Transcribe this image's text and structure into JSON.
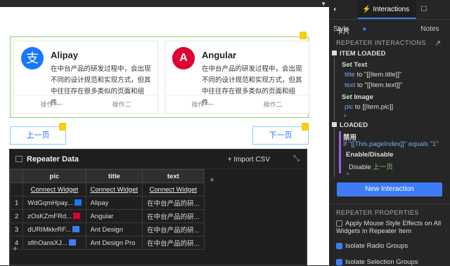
{
  "cards": [
    {
      "title": "Alipay",
      "desc": "在中台产品的研发过程中，会出现不同的设计规范和实现方式，但其中往往存在很多类似的页面和组件...",
      "action1": "操作一",
      "action2": "操作二",
      "logo_color": "#1677ff",
      "logo_glyph": "支"
    },
    {
      "title": "Angular",
      "desc": "在中台产品的研发过程中，会出现不同的设计规范和实现方式，但其中往往存在很多类似的页面和组件...",
      "action1": "操作一",
      "action2": "操作二",
      "logo_color": "#dd0031",
      "logo_glyph": "A"
    }
  ],
  "pager": {
    "prev": "上一页",
    "next": "下一页"
  },
  "repeater_data": {
    "title": "Repeater Data",
    "import_label": "Import CSV",
    "columns": [
      "pic",
      "title",
      "text"
    ],
    "connect_label": "Connect Widget",
    "rows": [
      {
        "n": "1",
        "pic": "WdGqmHpay...",
        "title": "Alipay",
        "text": "在中台产品的研..."
      },
      {
        "n": "2",
        "pic": "zOsKZmFRd...",
        "title": "Angular",
        "text": "在中台产品的研..."
      },
      {
        "n": "3",
        "pic": "dURIMkkrRF...",
        "title": "Ant Design",
        "text": "在中台产品的研..."
      },
      {
        "n": "4",
        "pic": "sfihOansXJ...",
        "title": "Ant Design Pro",
        "text": "在中台产品的研..."
      }
    ]
  },
  "sidebar": {
    "tabs": [
      "Style",
      "Interactions",
      "Notes"
    ],
    "widget_name": "卡片",
    "repeater_interactions": "REPEATER INTERACTIONS",
    "item_loaded": "ITEM LOADED",
    "set_text": "Set Text",
    "title_line_a": "title",
    "title_line_b": "to \"[[Item.title]]\"",
    "text_line_a": "text",
    "text_line_b": "to \"[[Item.text]]\"",
    "set_image": "Set Image",
    "pic_line_a": "pic",
    "pic_line_b": "to [[Item.pic]]",
    "loaded": "LOADED",
    "case_name": "禁用",
    "condition": "If \"[[This.pageIndex]]\" equals \"1\"",
    "enable_disable": "Enable/Disable",
    "disable_line_a": "Disable",
    "disable_line_b": "上一页",
    "new_interaction": "New Interaction",
    "repeater_properties": "REPEATER PROPERTIES",
    "prop1": "Apply Mouse Style Effects on All Widgets in Repeater Item",
    "prop2": "Isolate Radio Groups",
    "prop3": "Isolate Selection Groups",
    "prop1_checked": false,
    "prop2_checked": true,
    "prop3_checked": true,
    "plus": "+"
  }
}
